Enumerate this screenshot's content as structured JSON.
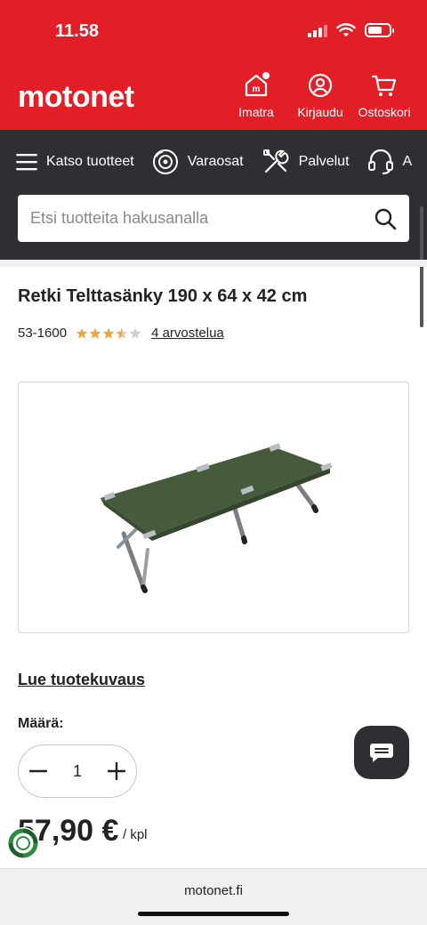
{
  "status_bar": {
    "time": "11.58"
  },
  "header": {
    "logo": "motonet",
    "actions": [
      {
        "label": "Imatra",
        "icon": "store-icon"
      },
      {
        "label": "Kirjaudu",
        "icon": "user-icon"
      },
      {
        "label": "Ostoskori",
        "icon": "cart-icon"
      }
    ]
  },
  "nav": {
    "items": [
      {
        "label": "Katso tuotteet",
        "icon": "menu-icon"
      },
      {
        "label": "Varaosat",
        "icon": "brake-disc-icon"
      },
      {
        "label": "Palvelut",
        "icon": "tools-icon"
      },
      {
        "label": "A",
        "icon": "headset-icon"
      }
    ]
  },
  "search": {
    "placeholder": "Etsi tuotteita hakusanalla"
  },
  "product": {
    "title": "Retki Telttasänky 190 x 64 x 42 cm",
    "sku": "53-1600",
    "rating": 3.5,
    "rating_max": 5,
    "reviews": "4 arvostelua",
    "image_alt": "Retki Telttasänky",
    "read_description": "Lue tuotekuvaus",
    "quantity_label": "Määrä:",
    "quantity": "1",
    "price": "57,90 €",
    "unit": "/ kpl"
  },
  "browser": {
    "url": "motonet.fi"
  },
  "colors": {
    "brand_red": "#e21f26",
    "nav_dark": "#2f2f33",
    "star": "#f2a53a"
  }
}
